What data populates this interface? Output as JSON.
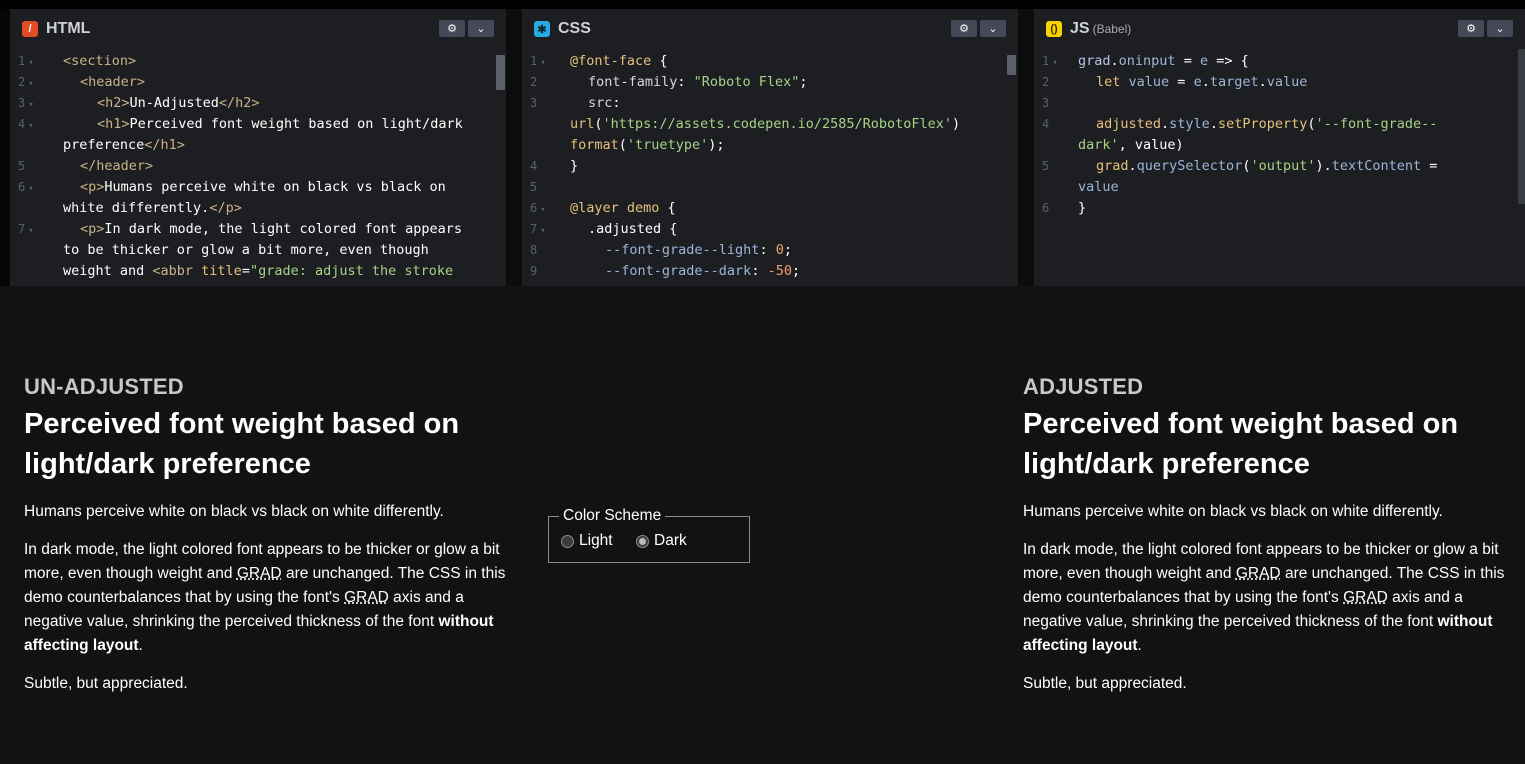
{
  "panes": [
    {
      "title": "HTML",
      "icon": "html-icon",
      "lines": [
        {
          "n": "1",
          "fold": true
        },
        {
          "n": "2",
          "fold": true
        },
        {
          "n": "3",
          "fold": true
        },
        {
          "n": "4",
          "fold": true
        },
        {
          "n": "",
          "fold": false
        },
        {
          "n": "5",
          "fold": false
        },
        {
          "n": "6",
          "fold": true
        },
        {
          "n": "",
          "fold": false
        },
        {
          "n": "7",
          "fold": true
        },
        {
          "n": "",
          "fold": false
        },
        {
          "n": "",
          "fold": false
        }
      ]
    },
    {
      "title": "CSS",
      "icon": "css-icon",
      "lines": [
        {
          "n": "1",
          "fold": true
        },
        {
          "n": "2",
          "fold": false
        },
        {
          "n": "3",
          "fold": false
        },
        {
          "n": "",
          "fold": false
        },
        {
          "n": "",
          "fold": false
        },
        {
          "n": "4",
          "fold": false
        },
        {
          "n": "5",
          "fold": false
        },
        {
          "n": "6",
          "fold": true
        },
        {
          "n": "7",
          "fold": true
        },
        {
          "n": "8",
          "fold": false
        },
        {
          "n": "9",
          "fold": false
        }
      ]
    },
    {
      "title": "JS",
      "subtitle": "(Babel)",
      "icon": "js-icon",
      "lines": [
        {
          "n": "1",
          "fold": true
        },
        {
          "n": "2",
          "fold": false
        },
        {
          "n": "3",
          "fold": false
        },
        {
          "n": "4",
          "fold": false
        },
        {
          "n": "",
          "fold": false
        },
        {
          "n": "5",
          "fold": false
        },
        {
          "n": "",
          "fold": false
        },
        {
          "n": "6",
          "fold": false
        }
      ]
    }
  ],
  "code": {
    "html": {
      "l1": "<section>",
      "l2": "<header>",
      "l3a": "<h2>",
      "l3b": "Un-Adjusted",
      "l3c": "</h2>",
      "l4a": "<h1>",
      "l4b": "Perceived font weight based on light/dark",
      "l4d": "preference",
      "l4e": "</h1>",
      "l5": "</header>",
      "l6a": "<p>",
      "l6b": "Humans perceive white on black vs black on",
      "l6d": "white differently.",
      "l6e": "</p>",
      "l7a": "<p>",
      "l7b": "In dark mode, the light colored font appears",
      "l7c": "to be thicker or glow a bit more, even though",
      "l7d": "weight and ",
      "l7e": "<abbr",
      "l7f": " title",
      "l7g": "=",
      "l7h": "\"grade: adjust the stroke"
    },
    "css": {
      "l1a": "@font-face",
      "l1b": " {",
      "l2a": "font-family",
      "l2b": ": ",
      "l2c": "\"Roboto Flex\"",
      "l2d": ";",
      "l3a": "src",
      "l3b": ":",
      "l3c": "url",
      "l3d": "(",
      "l3e": "'https://assets.codepen.io/2585/RobotoFlex'",
      "l3f": ")",
      "l3g": "format",
      "l3h": "(",
      "l3i": "'truetype'",
      "l3j": ");",
      "l4": "}",
      "l6a": "@layer",
      "l6b": " demo",
      "l6c": " {",
      "l7": ".adjusted {",
      "l8a": "--font-grade--light",
      "l8b": ": ",
      "l8c": "0",
      "l8d": ";",
      "l9a": "--font-grade--dark",
      "l9b": ": ",
      "l9c": "-50",
      "l9d": ";"
    },
    "js": {
      "l1a": "grad",
      "l1b": ".",
      "l1c": "oninput",
      "l1d": " = ",
      "l1e": "e",
      "l1f": " => {",
      "l2a": "let",
      "l2b": " value",
      "l2c": " = ",
      "l2d": "e",
      "l2e": ".",
      "l2f": "target",
      "l2g": ".",
      "l2h": "value",
      "l4a": "adjusted",
      "l4b": ".",
      "l4c": "style",
      "l4d": ".",
      "l4e": "setProperty",
      "l4f": "(",
      "l4g": "'--font-grade--",
      "l4h": "dark'",
      "l4i": ", value)",
      "l5a": "grad",
      "l5b": ".",
      "l5c": "querySelector",
      "l5d": "(",
      "l5e": "'output'",
      "l5f": ").",
      "l5g": "textContent",
      "l5h": " =",
      "l5i": "value",
      "l6": "}"
    }
  },
  "preview": {
    "left": {
      "h2": "UN-ADJUSTED",
      "h1": "Perceived font weight based on light/dark preference"
    },
    "right": {
      "h2": "ADJUSTED",
      "h1": "Perceived font weight based on light/dark preference"
    },
    "p1": "Humans perceive white on black vs black on white differently.",
    "p2a": "In dark mode, the light colored font appears to be thicker or glow a bit more, even though weight and ",
    "abbr1": "GRAD",
    "p2b": " are unchanged. The CSS in this demo counterbalances that by using the font's ",
    "abbr2": "GRAD",
    "p2c": " axis and a negative value, shrinking the perceived thickness of the font ",
    "p2bold": "without affecting layout",
    "p2end": ".",
    "p3": "Subtle, but appreciated.",
    "color_scheme": {
      "legend": "Color Scheme",
      "options": [
        "Light",
        "Dark"
      ],
      "selected": "Dark"
    }
  },
  "colors": {
    "editor_bg": "#1d1e22",
    "preview_bg": "#121212",
    "html_icon": "#e34c26",
    "css_icon": "#29a9df",
    "js_icon": "#f7d300",
    "button_bg": "#444857"
  }
}
